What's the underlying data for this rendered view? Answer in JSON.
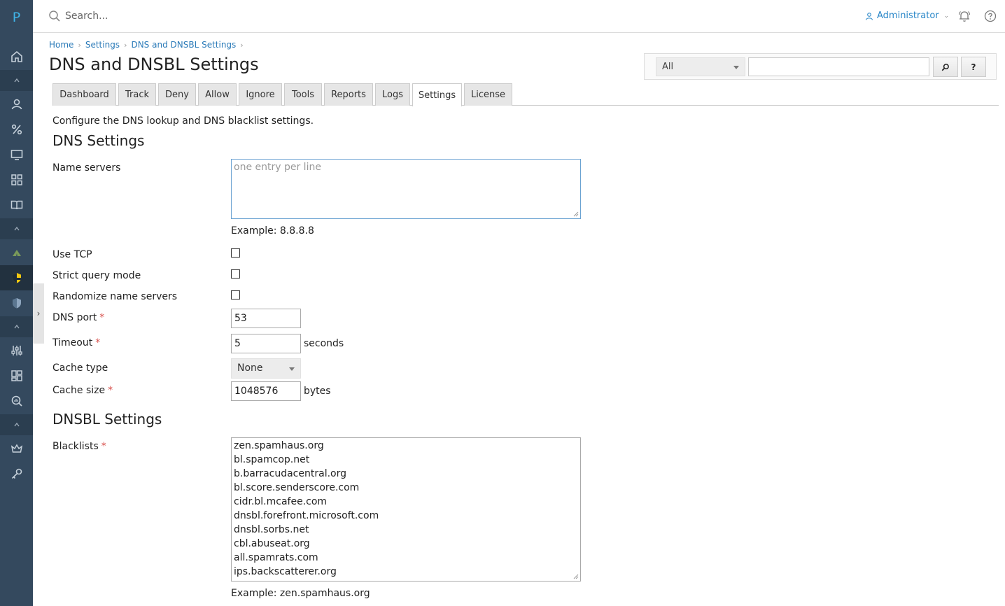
{
  "app": {
    "logo_letter": "P"
  },
  "topbar": {
    "search_placeholder": "Search...",
    "user_label": "Administrator"
  },
  "sidebar": {
    "items": [
      "home-icon",
      "chevron-up-icon",
      "user-icon",
      "percent-icon",
      "monitor-icon",
      "grid-icon",
      "book-icon",
      "chevron-up-icon",
      "tent-icon",
      "shield-icon",
      "shield-alt-icon",
      "chevron-up-icon",
      "sliders-icon",
      "layout-icon",
      "search-chart-icon",
      "chevron-up-icon",
      "crown-icon",
      "key-icon"
    ],
    "active_color": "#22313f",
    "accent_color": "#3fb4e8"
  },
  "breadcrumb": [
    "Home",
    "Settings",
    "DNS and DNSBL Settings"
  ],
  "page": {
    "title": "DNS and DNSBL Settings",
    "description": "Configure the DNS lookup and DNS blacklist settings."
  },
  "filter": {
    "select_value": "All",
    "search_button": "⌕",
    "help_button": "?"
  },
  "tabs": [
    {
      "label": "Dashboard"
    },
    {
      "label": "Track"
    },
    {
      "label": "Deny"
    },
    {
      "label": "Allow"
    },
    {
      "label": "Ignore"
    },
    {
      "label": "Tools"
    },
    {
      "label": "Reports"
    },
    {
      "label": "Logs"
    },
    {
      "label": "Settings",
      "active": true
    },
    {
      "label": "License"
    }
  ],
  "dns": {
    "heading": "DNS Settings",
    "name_servers_label": "Name servers",
    "name_servers_placeholder": "one entry per line",
    "name_servers_example": "Example: 8.8.8.8",
    "use_tcp_label": "Use TCP",
    "use_tcp_checked": false,
    "strict_label": "Strict query mode",
    "strict_checked": false,
    "randomize_label": "Randomize name servers",
    "randomize_checked": false,
    "port_label": "DNS port",
    "port_value": "53",
    "timeout_label": "Timeout",
    "timeout_value": "5",
    "timeout_unit": "seconds",
    "cache_type_label": "Cache type",
    "cache_type_value": "None",
    "cache_size_label": "Cache size",
    "cache_size_value": "1048576",
    "cache_size_unit": "bytes",
    "required_mark": "*"
  },
  "dnsbl": {
    "heading": "DNSBL Settings",
    "blacklists_label": "Blacklists",
    "blacklists": [
      "zen.spamhaus.org",
      "bl.spamcop.net",
      "b.barracudacentral.org",
      "bl.score.senderscore.com",
      "cidr.bl.mcafee.com",
      "dnsbl.forefront.microsoft.com",
      "dnsbl.sorbs.net",
      "cbl.abuseat.org",
      "all.spamrats.com",
      "ips.backscatterer.org"
    ],
    "example": "Example: zen.spamhaus.org"
  }
}
